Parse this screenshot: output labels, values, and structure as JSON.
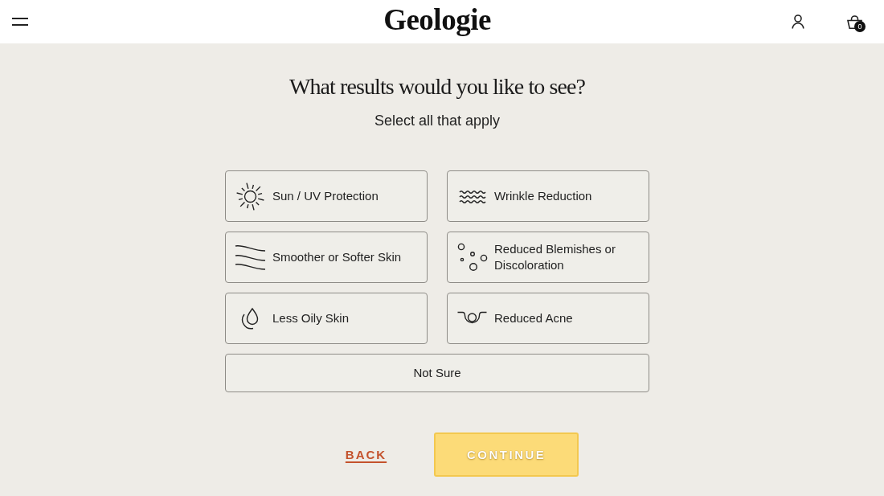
{
  "header": {
    "logo": "Geologie",
    "cart_count": "0"
  },
  "question": {
    "title": "What results would you like to see?",
    "subtitle": "Select all that apply"
  },
  "options": [
    {
      "label": "Sun / UV Protection",
      "selected": false
    },
    {
      "label": "Smoother or Softer Skin",
      "selected": false
    },
    {
      "label": "Less Oily Skin",
      "selected": false
    },
    {
      "label": "Wrinkle Reduction",
      "selected": false
    },
    {
      "label": "Reduced Blemishes or Discoloration",
      "selected": false
    },
    {
      "label": "Reduced Acne",
      "selected": false
    }
  ],
  "none_option": {
    "label": "Not Sure",
    "selected": false
  },
  "back": {
    "label": "BACK"
  },
  "continue": {
    "label": "CONTINUE",
    "disabled": true
  }
}
